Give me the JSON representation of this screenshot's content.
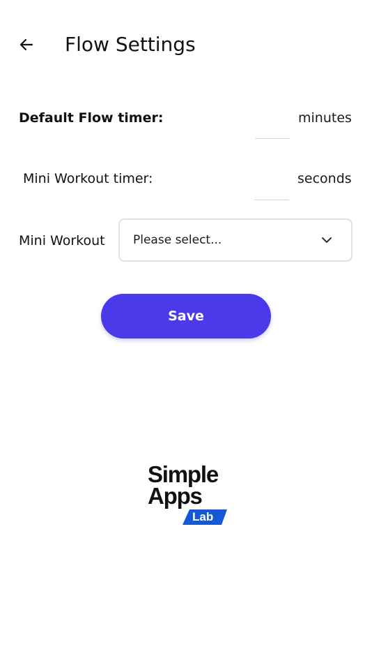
{
  "header": {
    "title": "Flow Settings",
    "back_icon": "arrow-left-icon"
  },
  "settings": {
    "flow_timer": {
      "label": "Default Flow timer:",
      "value": "",
      "unit": "minutes"
    },
    "mini_timer": {
      "label": "Mini Workout timer:",
      "value": "",
      "unit": "seconds"
    },
    "mini_workout": {
      "label": "Mini Workout",
      "selected": "Please select...",
      "chevron_icon": "chevron-down-icon"
    }
  },
  "actions": {
    "save_label": "Save"
  },
  "logo": {
    "line1": "Simple",
    "line2": "Apps",
    "badge": "Lab"
  },
  "colors": {
    "accent": "#4a3aea",
    "badge": "#1458d6"
  }
}
